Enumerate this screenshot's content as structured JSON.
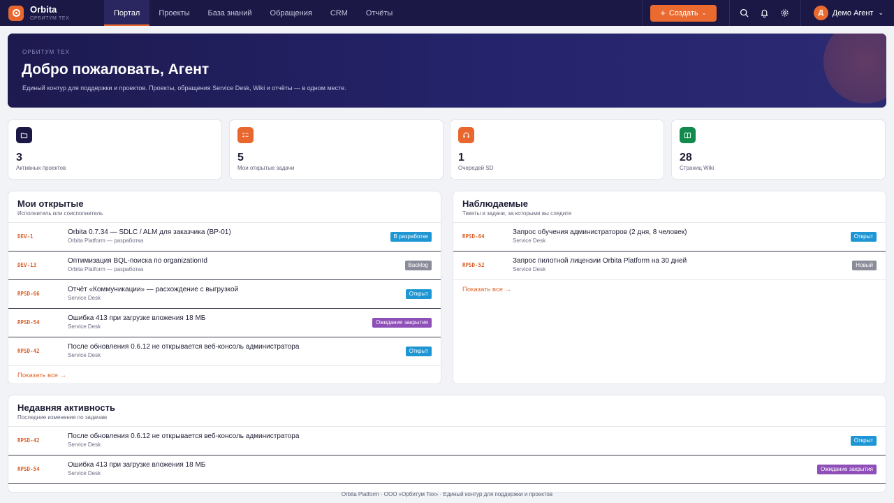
{
  "brand": {
    "name": "Orbita",
    "subtitle": "ОРБИТУМ ТЕХ"
  },
  "nav": [
    {
      "label": "Портал",
      "active": true
    },
    {
      "label": "Проекты"
    },
    {
      "label": "База знаний"
    },
    {
      "label": "Обращения"
    },
    {
      "label": "CRM"
    },
    {
      "label": "Отчёты"
    }
  ],
  "create_button": {
    "label": "Создать"
  },
  "user": {
    "initial": "Д",
    "name": "Демо Агент"
  },
  "hero": {
    "kicker": "ОРБИТУМ ТЕХ",
    "title": "Добро пожаловать, Агент",
    "description": "Единый контур для поддержки и проектов. Проекты, обращения Service Desk, Wiki и отчёты — в одном месте."
  },
  "stats": [
    {
      "value": "3",
      "label": "Активных проектов",
      "icon": "folder-icon",
      "color": "#1b1845"
    },
    {
      "value": "5",
      "label": "Мои открытые задачи",
      "icon": "tasks-icon",
      "color": "#e8672e"
    },
    {
      "value": "1",
      "label": "Очередей SD",
      "icon": "headset-icon",
      "color": "#e8672e"
    },
    {
      "value": "28",
      "label": "Страниц Wiki",
      "icon": "book-icon",
      "color": "#118a4e"
    }
  ],
  "my_open": {
    "title": "Мои открытые",
    "subtitle": "Исполнитель или соисполнитель",
    "items": [
      {
        "key": "DEV-1",
        "title": "Orbita 0.7.34 — SDLC / ALM для заказчика (ВР-01)",
        "sub": "Orbita Platform — разработка",
        "status": "В разработке",
        "status_color": "#1f96d4"
      },
      {
        "key": "DEV-13",
        "title": "Оптимизация BQL-поиска по organizationId",
        "sub": "Orbita Platform — разработка",
        "status": "Backlog",
        "status_color": "#8a8d99"
      },
      {
        "key": "RPSD-66",
        "title": "Отчёт «Коммуникации» — расхождение с выгрузкой",
        "sub": "Service Desk",
        "status": "Открыт",
        "status_color": "#1f96d4"
      },
      {
        "key": "RPSD-54",
        "title": "Ошибка 413 при загрузке вложения 18 МБ",
        "sub": "Service Desk",
        "status": "Ожидание закрытия",
        "status_color": "#8f4fb8"
      },
      {
        "key": "RPSD-42",
        "title": "После обновления 0.6.12 не открывается веб-консоль администратора",
        "sub": "Service Desk",
        "status": "Открыт",
        "status_color": "#1f96d4"
      }
    ],
    "show_all": "Показать все →"
  },
  "watched": {
    "title": "Наблюдаемые",
    "subtitle": "Тикеты и задачи, за которыми вы следите",
    "items": [
      {
        "key": "RPSD-64",
        "title": "Запрос обучения администраторов (2 дня, 8 человек)",
        "sub": "Service Desk",
        "status": "Открыт",
        "status_color": "#1f96d4"
      },
      {
        "key": "RPSD-52",
        "title": "Запрос пилотной лицензии Orbita Platform на 30 дней",
        "sub": "Service Desk",
        "status": "Новый",
        "status_color": "#8a8d99"
      }
    ],
    "show_all": "Показать все →"
  },
  "activity": {
    "title": "Недавняя активность",
    "subtitle": "Последние изменения по задачам",
    "items": [
      {
        "key": "RPSD-42",
        "title": "После обновления 0.6.12 не открывается веб-консоль администратора",
        "sub": "Service Desk",
        "status": "Открыт",
        "status_color": "#1f96d4"
      },
      {
        "key": "RPSD-54",
        "title": "Ошибка 413 при загрузке вложения 18 МБ",
        "sub": "Service Desk",
        "status": "Ожидание закрытия",
        "status_color": "#8f4fb8"
      }
    ]
  },
  "footer": "Orbita Platform · ООО «Орбитум Тех» · Единый контур для поддержки и проектов",
  "colors": {
    "accent": "#e8672e",
    "navy": "#1b1845"
  }
}
